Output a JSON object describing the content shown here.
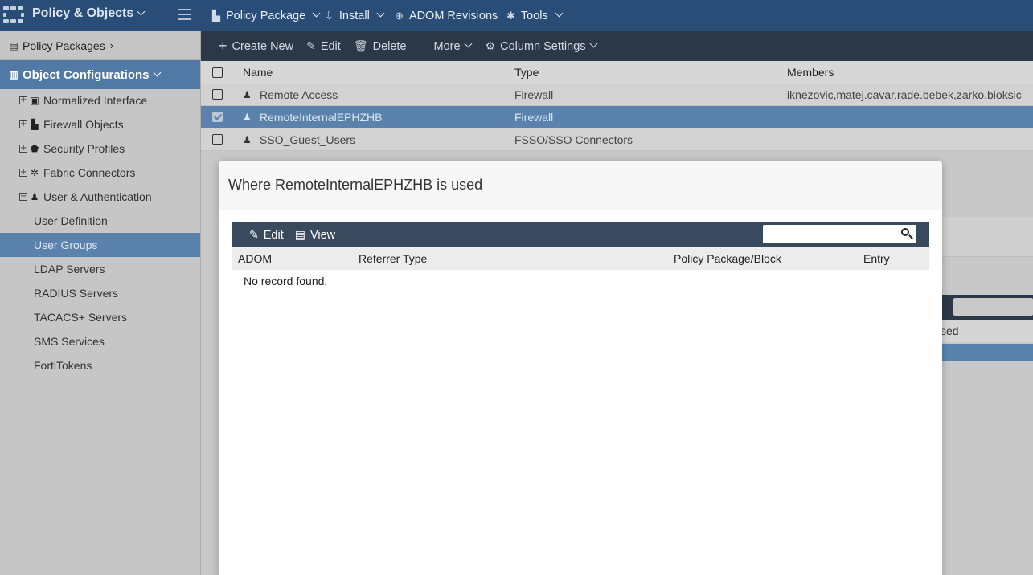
{
  "app": {
    "title": "Policy & Objects"
  },
  "top_menu": [
    {
      "label": "Policy Package",
      "icon": "package-icon",
      "glyph": "▙"
    },
    {
      "label": "Install",
      "icon": "install-icon",
      "glyph": "⇩"
    },
    {
      "label": "ADOM Revisions",
      "icon": "globe-icon",
      "glyph": "⊕"
    },
    {
      "label": "Tools",
      "icon": "gear-icon",
      "glyph": "✱"
    }
  ],
  "sidebar": {
    "policy_packages": "Policy Packages",
    "object_configurations": "Object Configurations",
    "tree_items": [
      {
        "label": "Normalized Interface",
        "icon": "interface-icon",
        "glyph": "▣"
      },
      {
        "label": "Firewall Objects",
        "icon": "firewall-icon",
        "glyph": "▙"
      },
      {
        "label": "Security Profiles",
        "icon": "shield-icon",
        "glyph": "⬟"
      },
      {
        "label": "Fabric Connectors",
        "icon": "fabric-icon",
        "glyph": "✲"
      },
      {
        "label": "User & Authentication",
        "icon": "users-icon",
        "glyph": "♟"
      }
    ],
    "leaf_items": [
      {
        "label": "User Definition",
        "active": false
      },
      {
        "label": "User Groups",
        "active": true
      },
      {
        "label": "LDAP Servers",
        "active": false
      },
      {
        "label": "RADIUS Servers",
        "active": false
      },
      {
        "label": "TACACS+ Servers",
        "active": false
      },
      {
        "label": "SMS Services",
        "active": false
      },
      {
        "label": "FortiTokens",
        "active": false
      }
    ]
  },
  "toolbar": {
    "create_new": "Create New",
    "edit": "Edit",
    "delete": "Delete",
    "more": "More",
    "column_settings": "Column Settings"
  },
  "table": {
    "columns": [
      "Name",
      "Type",
      "Members"
    ],
    "rows": [
      {
        "name": "Remote Access",
        "type": "Firewall",
        "members": "iknezovic,matej.cavar,rade.bebek,zarko.bioksic",
        "selected": false
      },
      {
        "name": "RemoteInternalEPHZHB",
        "type": "Firewall",
        "members": "",
        "selected": true
      },
      {
        "name": "SSO_Guest_Users",
        "type": "FSSO/SSO Connectors",
        "members": "",
        "selected": false
      }
    ]
  },
  "background_fragment": {
    "header_partial": "sed"
  },
  "modal": {
    "title": "Where RemoteInternalEPHZHB is used",
    "edit": "Edit",
    "view": "View",
    "search_placeholder": "",
    "columns": [
      "ADOM",
      "Referrer Type",
      "Policy Package/Block",
      "Entry"
    ],
    "empty_message": "No record found."
  },
  "colors": {
    "topbar": "#294d77",
    "toolbar": "#2b3848",
    "sidebar_active": "#5079a6",
    "selection": "#5a82ac",
    "modal_toolbar": "#3a4a5e"
  }
}
